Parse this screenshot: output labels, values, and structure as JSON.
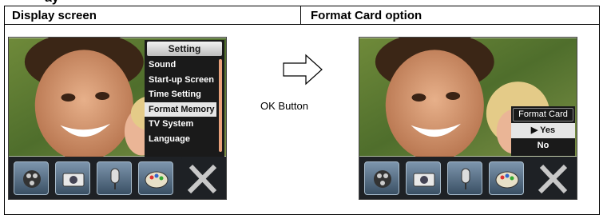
{
  "top_fragment": "ay",
  "table": {
    "headers": [
      "Display screen",
      "Format Card option"
    ]
  },
  "left_screen": {
    "menu_title": "Setting",
    "menu_items": [
      "Sound",
      "Start-up Screen",
      "Time Setting",
      "Format Memory",
      "TV System",
      "Language"
    ],
    "selected_index": 3
  },
  "right_screen": {
    "dialog_title": "Format Card",
    "options": [
      "▶ Yes",
      "No"
    ],
    "selected_index": 0
  },
  "icon_bar": [
    "film-icon",
    "camera-icon",
    "microphone-icon",
    "palette-icon",
    "tools-icon"
  ],
  "arrow_label": "OK Button"
}
